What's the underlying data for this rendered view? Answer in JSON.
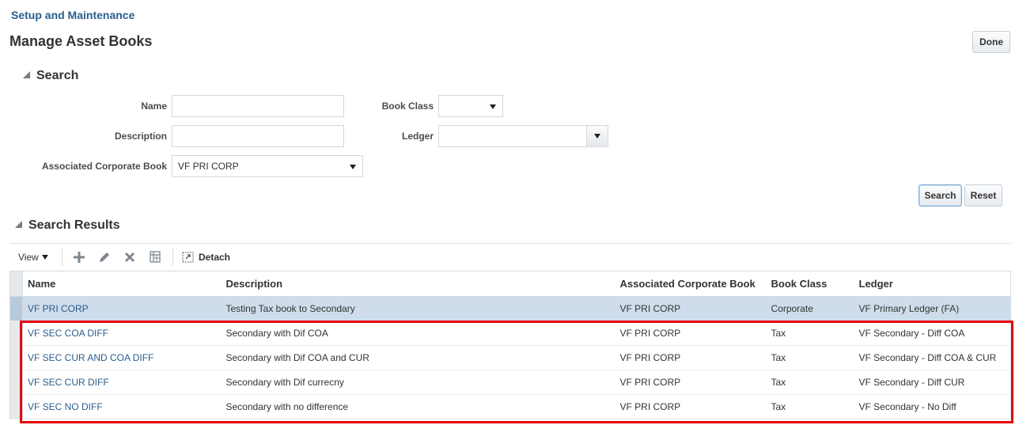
{
  "breadcrumb": "Setup and Maintenance",
  "page_title": "Manage Asset Books",
  "done_label": "Done",
  "search": {
    "heading": "Search",
    "name_label": "Name",
    "name_value": "",
    "description_label": "Description",
    "description_value": "",
    "assoc_book_label": "Associated Corporate Book",
    "assoc_book_value": "VF PRI CORP",
    "book_class_label": "Book Class",
    "book_class_value": "",
    "ledger_label": "Ledger",
    "ledger_value": "",
    "search_button": "Search",
    "reset_button": "Reset"
  },
  "results": {
    "heading": "Search Results",
    "toolbar": {
      "view_label": "View",
      "detach_label": "Detach",
      "icons": [
        "add-icon",
        "edit-icon",
        "delete-icon",
        "freeze-icon",
        "detach-icon"
      ]
    },
    "columns": [
      "Name",
      "Description",
      "Associated Corporate Book",
      "Book Class",
      "Ledger"
    ],
    "rows": [
      {
        "name": "VF PRI CORP",
        "description": "Testing Tax book to Secondary",
        "assoc": "VF PRI CORP",
        "book_class": "Corporate",
        "ledger": "VF Primary Ledger (FA)"
      },
      {
        "name": "VF SEC COA DIFF",
        "description": "Secondary with Dif COA",
        "assoc": "VF PRI CORP",
        "book_class": "Tax",
        "ledger": "VF Secondary - Diff COA"
      },
      {
        "name": "VF SEC CUR AND COA DIFF",
        "description": "Secondary with Dif COA and CUR",
        "assoc": "VF PRI CORP",
        "book_class": "Tax",
        "ledger": "VF Secondary - Diff COA & CUR"
      },
      {
        "name": "VF SEC CUR DIFF",
        "description": "Secondary with Dif currecny",
        "assoc": "VF PRI CORP",
        "book_class": "Tax",
        "ledger": "VF Secondary - Diff CUR"
      },
      {
        "name": "VF SEC NO DIFF",
        "description": "Secondary with no difference",
        "assoc": "VF PRI CORP",
        "book_class": "Tax",
        "ledger": "VF Secondary - No Diff"
      }
    ]
  },
  "colors": {
    "link": "#2a5d8c",
    "selected_row": "#cfdceb",
    "highlight_box": "#e3000f"
  }
}
